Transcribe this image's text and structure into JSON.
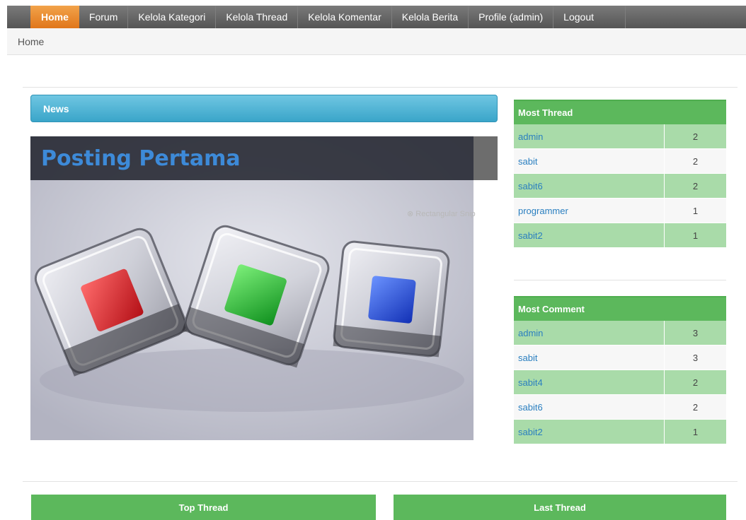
{
  "nav": {
    "items": [
      {
        "label": "Home",
        "active": true
      },
      {
        "label": "Forum"
      },
      {
        "label": "Kelola Kategori"
      },
      {
        "label": "Kelola Thread"
      },
      {
        "label": "Kelola Komentar"
      },
      {
        "label": "Kelola Berita"
      },
      {
        "label": "Profile (admin)"
      },
      {
        "label": "Logout"
      }
    ]
  },
  "breadcrumb": "Home",
  "news": {
    "header": "News",
    "title": "Posting Pertama",
    "overlay_hint": "Rectangular Snip"
  },
  "most_thread": {
    "title": "Most Thread",
    "rows": [
      {
        "name": "admin",
        "count": "2"
      },
      {
        "name": "sabit",
        "count": "2"
      },
      {
        "name": "sabit6",
        "count": "2"
      },
      {
        "name": "programmer",
        "count": "1"
      },
      {
        "name": "sabit2",
        "count": "1"
      }
    ]
  },
  "most_comment": {
    "title": "Most Comment",
    "rows": [
      {
        "name": "admin",
        "count": "3"
      },
      {
        "name": "sabit",
        "count": "3"
      },
      {
        "name": "sabit4",
        "count": "2"
      },
      {
        "name": "sabit6",
        "count": "2"
      },
      {
        "name": "sabit2",
        "count": "1"
      }
    ]
  },
  "bottom": {
    "top_thread": "Top Thread",
    "last_thread": "Last Thread"
  },
  "colors": {
    "nav_active": "#e0761b",
    "news_bar": "#3aa5c9",
    "table_header": "#5cb85c",
    "table_row_alt": "#a9dba9",
    "link": "#2a7fc0",
    "title_blue": "#3d8ad8"
  }
}
